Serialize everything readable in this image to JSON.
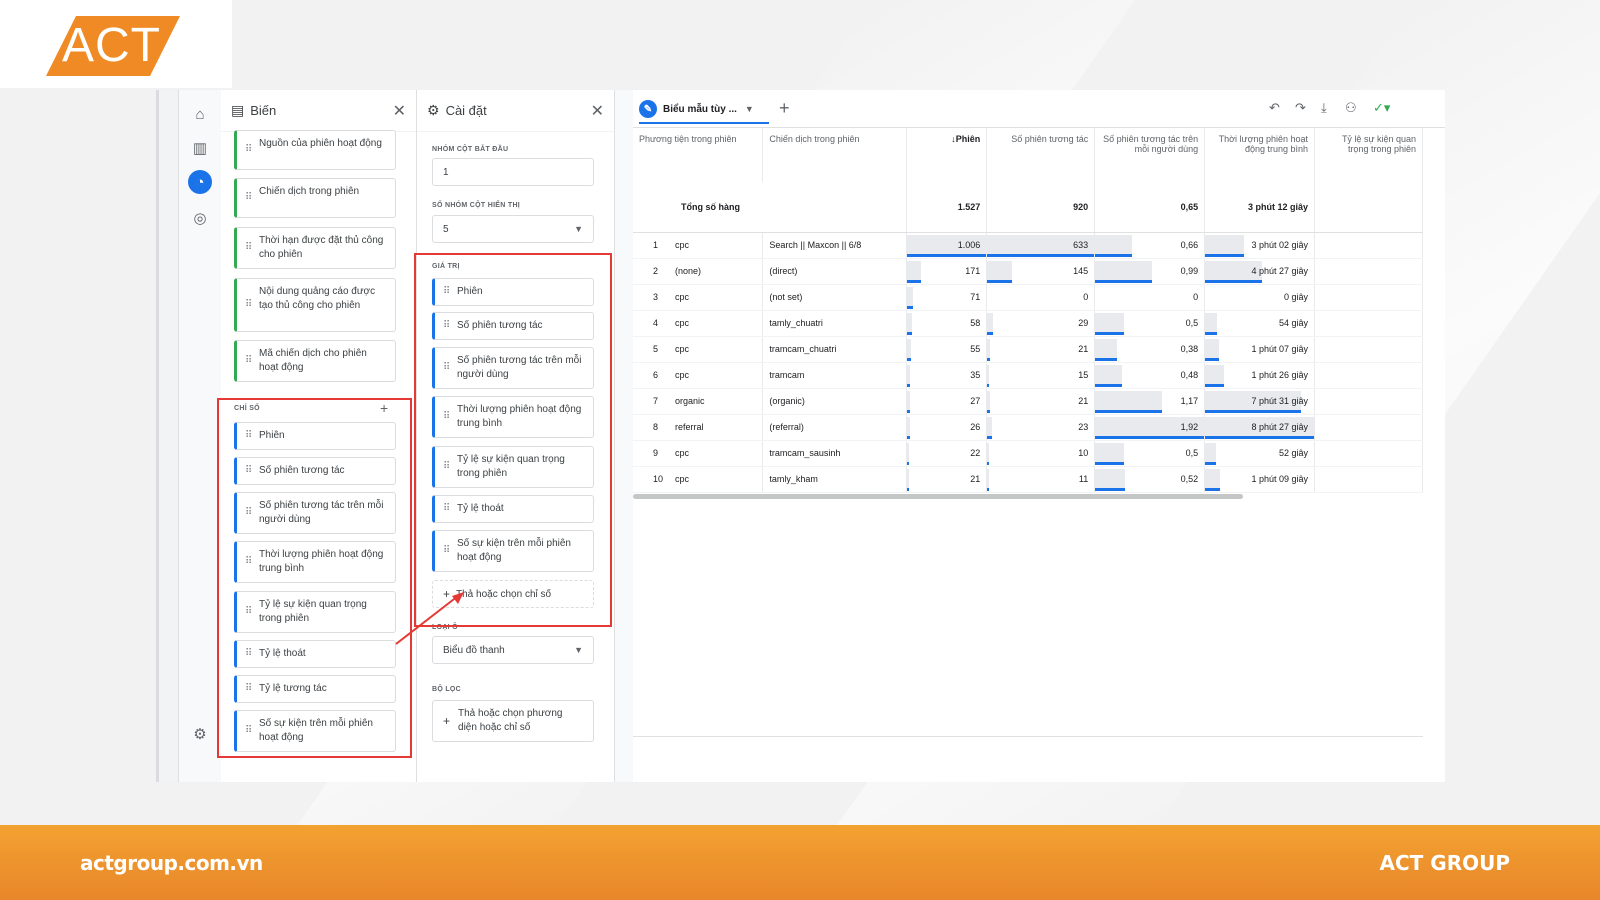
{
  "brand": {
    "logo_text": "ACT",
    "accent": "#f08a24"
  },
  "footer": {
    "website": "actgroup.com.vn",
    "company": "ACT GROUP"
  },
  "variables_panel": {
    "title": "Biến",
    "dimensions": [
      "Nguồn của phiên hoạt động",
      "Chiến dịch trong phiên",
      "Thời hạn được đặt thủ công cho phiên",
      "Nội dung quảng cáo được tạo thủ công cho phiên",
      "Mã chiến dịch cho phiên hoạt động"
    ],
    "metrics_label": "CHỈ SỐ",
    "metrics": [
      "Phiên",
      "Số phiên tương tác",
      "Số phiên tương tác trên mỗi người dùng",
      "Thời lượng phiên hoạt động trung bình",
      "Tỷ lệ sự kiện quan trọng trong phiên",
      "Tỷ lệ thoát",
      "Tỷ lệ tương tác",
      "Số sự kiện trên mỗi phiên hoạt động"
    ]
  },
  "settings_panel": {
    "title": "Cài đặt",
    "start_row_label": "NHÓM CỘT BẮT ĐẦU",
    "start_row_value": "1",
    "rows_shown_label": "SỐ NHÓM CỘT HIỂN THỊ",
    "rows_shown_value": "5",
    "values_label": "GIÁ TRỊ",
    "values": [
      "Phiên",
      "Số phiên tương tác",
      "Số phiên tương tác trên mỗi người dùng",
      "Thời lượng phiên hoạt động trung bình",
      "Tỷ lệ sự kiện quan trọng trong phiên",
      "Tỷ lệ thoát",
      "Số sự kiện trên mỗi phiên hoạt động"
    ],
    "drop_metric": "Thả hoặc chọn chỉ số",
    "type_label": "LOẠI Ô",
    "type_value": "Biểu đồ thanh",
    "filter_label": "BỘ LỌC",
    "filter_placeholder": "Thả hoặc chọn phương diện hoặc chỉ số"
  },
  "report": {
    "tab_label": "Biểu mẫu tùy ...",
    "columns": [
      "Phương tiện trong phiên",
      "Chiến dịch trong phiên",
      "↓Phiên",
      "Số phiên tương tác",
      "Số phiên tương tác trên mỗi người dùng",
      "Thời lượng phiên hoạt động trung bình",
      "Tỷ lệ sự kiện quan trọng trong phiên"
    ],
    "total_label": "Tổng số hàng",
    "totals": [
      "1.527",
      "920",
      "0,65",
      "3 phút 12 giây"
    ],
    "rows": [
      {
        "idx": "1",
        "medium": "cpc",
        "campaign": "Search || Maxcon || 6/8",
        "sessions": "1.006",
        "engaged": "633",
        "per_user": "0,66",
        "duration": "3 phút 02 giây",
        "s": 1.0,
        "e": 1.0,
        "p": 0.34,
        "d": 0.36
      },
      {
        "idx": "2",
        "medium": "(none)",
        "campaign": "(direct)",
        "sessions": "171",
        "engaged": "145",
        "per_user": "0,99",
        "duration": "4 phút 27 giây",
        "s": 0.17,
        "e": 0.23,
        "p": 0.52,
        "d": 0.52
      },
      {
        "idx": "3",
        "medium": "cpc",
        "campaign": "(not set)",
        "sessions": "71",
        "engaged": "0",
        "per_user": "0",
        "duration": "0 giây",
        "s": 0.07,
        "e": 0.0,
        "p": 0.0,
        "d": 0.0
      },
      {
        "idx": "4",
        "medium": "cpc",
        "campaign": "tamly_chuatri",
        "sessions": "58",
        "engaged": "29",
        "per_user": "0,5",
        "duration": "54 giây",
        "s": 0.06,
        "e": 0.05,
        "p": 0.26,
        "d": 0.11
      },
      {
        "idx": "5",
        "medium": "cpc",
        "campaign": "tramcam_chuatri",
        "sessions": "55",
        "engaged": "21",
        "per_user": "0,38",
        "duration": "1 phút 07 giây",
        "s": 0.05,
        "e": 0.03,
        "p": 0.2,
        "d": 0.13
      },
      {
        "idx": "6",
        "medium": "cpc",
        "campaign": "tramcam",
        "sessions": "35",
        "engaged": "15",
        "per_user": "0,48",
        "duration": "1 phút 26 giây",
        "s": 0.03,
        "e": 0.02,
        "p": 0.25,
        "d": 0.17
      },
      {
        "idx": "7",
        "medium": "organic",
        "campaign": "(organic)",
        "sessions": "27",
        "engaged": "21",
        "per_user": "1,17",
        "duration": "7 phút 31 giây",
        "s": 0.03,
        "e": 0.03,
        "p": 0.61,
        "d": 0.88
      },
      {
        "idx": "8",
        "medium": "referral",
        "campaign": "(referral)",
        "sessions": "26",
        "engaged": "23",
        "per_user": "1,92",
        "duration": "8 phút 27 giây",
        "s": 0.03,
        "e": 0.04,
        "p": 1.0,
        "d": 1.0
      },
      {
        "idx": "9",
        "medium": "cpc",
        "campaign": "tramcam_sausinh",
        "sessions": "22",
        "engaged": "10",
        "per_user": "0,5",
        "duration": "52 giây",
        "s": 0.02,
        "e": 0.02,
        "p": 0.26,
        "d": 0.1
      },
      {
        "idx": "10",
        "medium": "cpc",
        "campaign": "tamly_kham",
        "sessions": "21",
        "engaged": "11",
        "per_user": "0,52",
        "duration": "1 phút 09 giây",
        "s": 0.02,
        "e": 0.02,
        "p": 0.27,
        "d": 0.14
      }
    ]
  }
}
